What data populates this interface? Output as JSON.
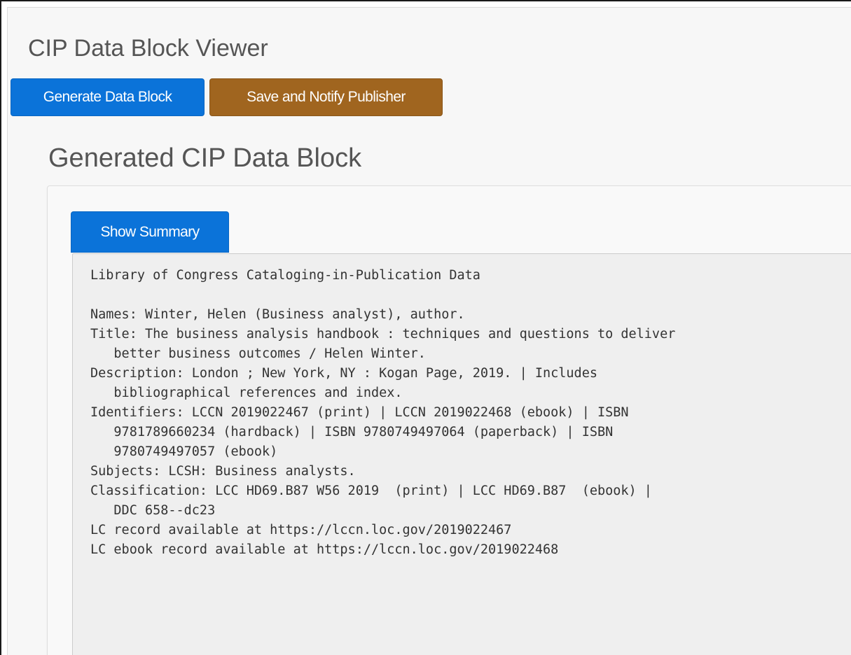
{
  "page": {
    "title": "CIP Data Block Viewer"
  },
  "toolbar": {
    "generate_label": "Generate Data Block",
    "save_label": "Save and Notify Publisher"
  },
  "section": {
    "title": "Generated CIP Data Block"
  },
  "panel": {
    "summary_button_label": "Show Summary",
    "cip_lines": [
      "Library of Congress Cataloging-in-Publication Data",
      "",
      "Names: Winter, Helen (Business analyst), author.",
      "Title: The business analysis handbook : techniques and questions to deliver",
      "   better business outcomes / Helen Winter.",
      "Description: London ; New York, NY : Kogan Page, 2019. | Includes",
      "   bibliographical references and index.",
      "Identifiers: LCCN 2019022467 (print) | LCCN 2019022468 (ebook) | ISBN",
      "   9781789660234 (hardback) | ISBN 9780749497064 (paperback) | ISBN",
      "   9780749497057 (ebook)",
      "Subjects: LCSH: Business analysts.",
      "Classification: LCC HD69.B87 W56 2019  (print) | LCC HD69.B87  (ebook) |",
      "   DDC 658--dc23",
      "LC record available at https://lccn.loc.gov/2019022467",
      "LC ebook record available at https://lccn.loc.gov/2019022468"
    ]
  },
  "colors": {
    "primary_button": "#0b73d9",
    "save_button": "#a0651f",
    "heading_text": "#555555",
    "page_background": "#f7f7f7",
    "cip_background": "#efefef"
  }
}
